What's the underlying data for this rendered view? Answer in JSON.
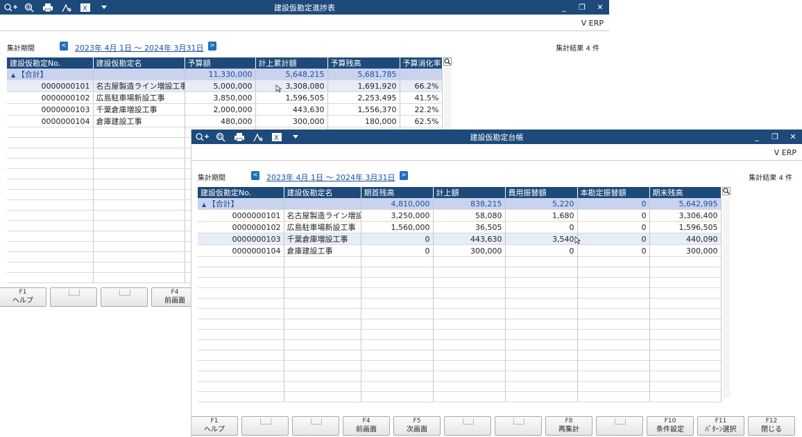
{
  "window1": {
    "title": "建設仮勘定進捗表",
    "brand": "V ERP",
    "period_label": "集計期間",
    "period_prev": "<",
    "period_range": "2023年  4月 1日   ～   2024年  3月31日",
    "period_next": ">",
    "result": "集計結果 4 件",
    "columns": [
      "建設仮勘定No.",
      "建設仮勘定名",
      "予算額",
      "計上累計額",
      "予算残高",
      "予算消化率"
    ],
    "total_row": [
      "【合計】",
      "",
      "11,330,000",
      "5,648,215",
      "5,681,785",
      ""
    ],
    "rows": [
      [
        "0000000101",
        "名古屋製造ライン増設工事",
        "5,000,000",
        "3,308,080",
        "1,691,920",
        "66.2%"
      ],
      [
        "0000000102",
        "広島駐車場新設工事",
        "3,850,000",
        "1,596,505",
        "2,253,495",
        "41.5%"
      ],
      [
        "0000000103",
        "千葉倉庫増設工事",
        "2,000,000",
        "443,630",
        "1,556,370",
        "22.2%"
      ],
      [
        "0000000104",
        "倉庫建設工事",
        "480,000",
        "300,000",
        "180,000",
        "62.5%"
      ]
    ],
    "fkeys": [
      {
        "num": "F1",
        "label": "ヘルプ"
      },
      {
        "num": "",
        "label": ""
      },
      {
        "num": "",
        "label": ""
      },
      {
        "num": "F4",
        "label": "前画面"
      }
    ]
  },
  "window2": {
    "title": "建設仮勘定台帳",
    "brand": "V ERP",
    "period_label": "集計期間",
    "period_prev": "<",
    "period_range": "2023年  4月 1日   ～   2024年  3月31日",
    "period_next": ">",
    "result": "集計結果 4 件",
    "columns": [
      "建設仮勘定No.",
      "建設仮勘定名",
      "期首残高",
      "計上額",
      "費用振替額",
      "本勘定振替額",
      "期末残高"
    ],
    "total_row": [
      "【合計】",
      "",
      "4,810,000",
      "838,215",
      "5,220",
      "0",
      "5,642,995"
    ],
    "rows": [
      [
        "0000000101",
        "名古屋製造ライン増設工事",
        "3,250,000",
        "58,080",
        "1,680",
        "0",
        "3,306,400"
      ],
      [
        "0000000102",
        "広島駐車場新設工事",
        "1,560,000",
        "36,505",
        "0",
        "0",
        "1,596,505"
      ],
      [
        "0000000103",
        "千葉倉庫増設工事",
        "0",
        "443,630",
        "3,540",
        "0",
        "440,090"
      ],
      [
        "0000000104",
        "倉庫建設工事",
        "0",
        "300,000",
        "0",
        "0",
        "300,000"
      ]
    ],
    "fkeys": [
      {
        "num": "F1",
        "label": "ヘルプ"
      },
      {
        "num": "",
        "label": ""
      },
      {
        "num": "",
        "label": ""
      },
      {
        "num": "F4",
        "label": "前画面"
      },
      {
        "num": "F5",
        "label": "次画面"
      },
      {
        "num": "",
        "label": ""
      },
      {
        "num": "",
        "label": ""
      },
      {
        "num": "F8",
        "label": "再集計"
      },
      {
        "num": "",
        "label": ""
      },
      {
        "num": "F10",
        "label": "条件設定"
      },
      {
        "num": "F11",
        "label": "ﾊﾟﾀｰﾝ選択"
      },
      {
        "num": "F12",
        "label": "閉じる"
      }
    ]
  },
  "titlebar_icons": [
    "search-plus-icon",
    "zoom-icon",
    "print-icon",
    "pdf-icon",
    "excel-icon",
    "dropdown-icon"
  ],
  "window_controls": [
    "minimize",
    "restore",
    "close"
  ],
  "colors": {
    "titlebar": "#1d4a7a",
    "header": "#1d4a7a",
    "total_row": "#c9d3ee",
    "link": "#1a4fa0",
    "nav_button": "#1e6fbf"
  }
}
